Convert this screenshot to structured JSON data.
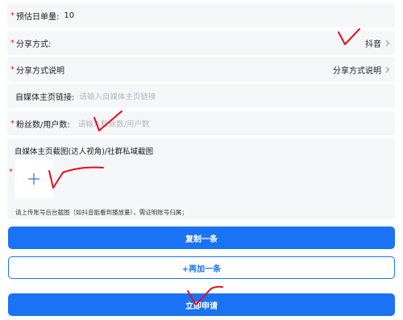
{
  "rows": {
    "daily_orders": {
      "label": "预估日单量:",
      "value": "10"
    },
    "share_method": {
      "label": "分享方式:",
      "value": "抖音"
    },
    "share_desc": {
      "label": "分享方式说明",
      "value": "分享方式说明"
    },
    "homepage_link": {
      "label": "自媒体主页链接:",
      "placeholder": "请输入自媒体主页链接"
    },
    "followers": {
      "label": "粉丝数/用户数:",
      "placeholder": "请输入粉丝数/用户数"
    }
  },
  "upload": {
    "title": "自媒体主页截图(达人视角)/社群私域截图",
    "hint": "请上传账号后台截图（如抖音能看到播放量），需证明账号归属；"
  },
  "buttons": {
    "copy": "复制一条",
    "add_more": "+再加一条",
    "submit": "立即申请"
  },
  "required_mark": "*",
  "colors": {
    "primary": "#1a73f5",
    "required": "#e02020",
    "field_bg": "#f5f6f8",
    "annotation": "#e3101a"
  }
}
